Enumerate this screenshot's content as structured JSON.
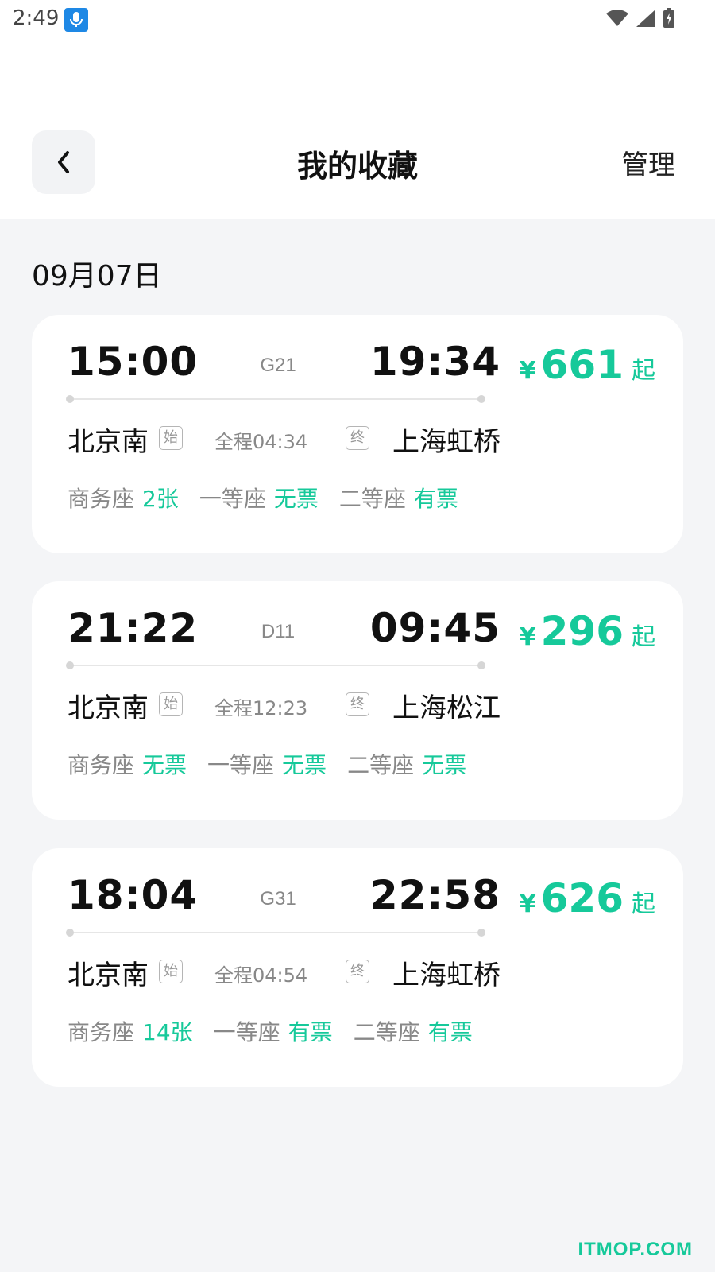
{
  "status_bar": {
    "time": "2:49"
  },
  "header": {
    "title": "我的收藏",
    "manage_label": "管理"
  },
  "date_label": "09月07日",
  "trains": [
    {
      "dep_time": "15:00",
      "train_no": "G21",
      "arr_time": "19:34",
      "from": "北京南",
      "start_tag": "始",
      "duration": "全程04:34",
      "end_tag": "终",
      "to": "上海虹桥",
      "seats": [
        {
          "label": "商务座",
          "status": "2张"
        },
        {
          "label": "一等座",
          "status": "无票"
        },
        {
          "label": "二等座",
          "status": "有票"
        }
      ],
      "price_symbol": "¥",
      "price": "661",
      "price_suffix": "起"
    },
    {
      "dep_time": "21:22",
      "train_no": "D11",
      "arr_time": "09:45",
      "from": "北京南",
      "start_tag": "始",
      "duration": "全程12:23",
      "end_tag": "终",
      "to": "上海松江",
      "seats": [
        {
          "label": "商务座",
          "status": "无票"
        },
        {
          "label": "一等座",
          "status": "无票"
        },
        {
          "label": "二等座",
          "status": "无票"
        }
      ],
      "price_symbol": "¥",
      "price": "296",
      "price_suffix": "起"
    },
    {
      "dep_time": "18:04",
      "train_no": "G31",
      "arr_time": "22:58",
      "from": "北京南",
      "start_tag": "始",
      "duration": "全程04:54",
      "end_tag": "终",
      "to": "上海虹桥",
      "seats": [
        {
          "label": "商务座",
          "status": "14张"
        },
        {
          "label": "一等座",
          "status": "有票"
        },
        {
          "label": "二等座",
          "status": "有票"
        }
      ],
      "price_symbol": "¥",
      "price": "626",
      "price_suffix": "起"
    }
  ],
  "watermark": "ITMOP.COM",
  "colors": {
    "accent": "#16c99a",
    "background": "#f4f5f7"
  }
}
